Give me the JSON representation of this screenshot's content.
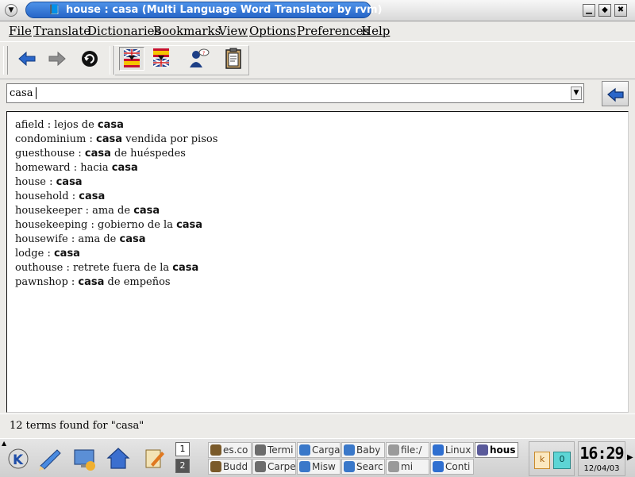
{
  "window": {
    "title": "house : casa  (Multi Language Word Translator by rvm)"
  },
  "menu": [
    "File",
    "Translate",
    "Dictionaries",
    "Bookmarks",
    "View",
    "Options",
    "Preferences",
    "Help"
  ],
  "toolbar": {
    "buttons": [
      "back-icon",
      "forward-icon",
      "reload-icon",
      "english-to-spanish-flag-icon",
      "spanish-to-english-flag-icon",
      "speaker-icon",
      "clipboard-icon"
    ]
  },
  "search": {
    "value": "casa"
  },
  "results": [
    {
      "pre": "afield : lejos de ",
      "bold": "casa",
      "post": ""
    },
    {
      "pre": "condominium : ",
      "bold": "casa",
      "post": " vendida por pisos"
    },
    {
      "pre": "guesthouse : ",
      "bold": "casa",
      "post": " de huéspedes"
    },
    {
      "pre": "homeward : hacia ",
      "bold": "casa",
      "post": ""
    },
    {
      "pre": "house : ",
      "bold": "casa",
      "post": ""
    },
    {
      "pre": "household : ",
      "bold": "casa",
      "post": ""
    },
    {
      "pre": "housekeeper : ama de ",
      "bold": "casa",
      "post": ""
    },
    {
      "pre": "housekeeping : gobierno de la ",
      "bold": "casa",
      "post": ""
    },
    {
      "pre": "housewife : ama de ",
      "bold": "casa",
      "post": ""
    },
    {
      "pre": "lodge : ",
      "bold": "casa",
      "post": ""
    },
    {
      "pre": "outhouse : retrete fuera de la ",
      "bold": "casa",
      "post": ""
    },
    {
      "pre": "pawnshop : ",
      "bold": "casa",
      "post": " de empeños"
    }
  ],
  "status": "12 terms found for \"casa\"",
  "taskbar": {
    "desktops": [
      "1",
      "2"
    ],
    "tasks_row1": [
      "es.co",
      "Termi",
      "Carga",
      "Baby",
      "file:/",
      "Linux",
      "hous"
    ],
    "tasks_row2": [
      "Budd",
      "Carpe",
      "Misw",
      "Searc",
      "mi",
      "Conti"
    ],
    "tray_badge": "0",
    "clock_time": "16:29",
    "clock_date": "12/04/03"
  },
  "colors": {
    "title_active": "#2f72d6",
    "results_bg": "#ffffff"
  }
}
